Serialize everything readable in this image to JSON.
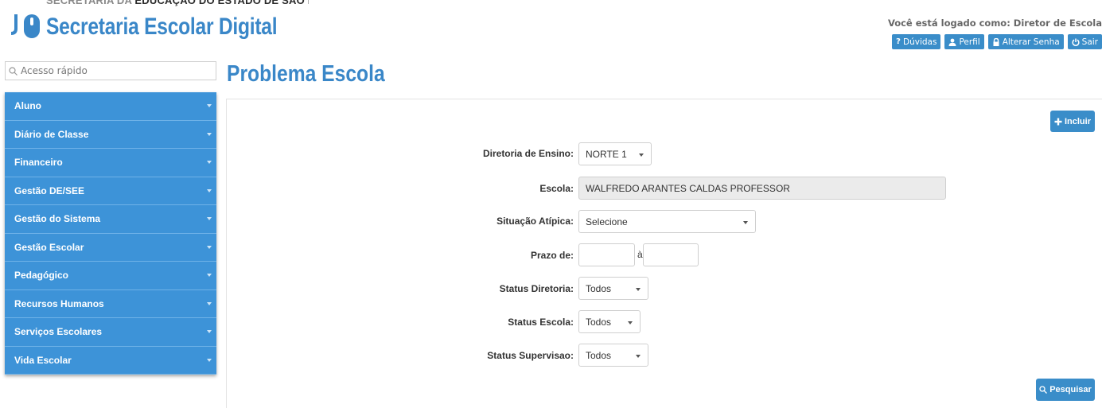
{
  "header": {
    "supertitle_dim": "SECRETARIA DA",
    "supertitle": "EDUCAÇÃO DO ESTADO DE SÃO PAULO",
    "app_title": "Secretaria Escolar Digital",
    "logged_as": "Você está logado como: Diretor de Escola",
    "buttons": [
      {
        "label": "Dúvidas",
        "icon": "question-icon"
      },
      {
        "label": "Perfil",
        "icon": "user-icon"
      },
      {
        "label": "Alterar Senha",
        "icon": "lock-icon"
      },
      {
        "label": "Sair",
        "icon": "power-icon"
      }
    ]
  },
  "quick_search": {
    "placeholder": "Acesso rápido",
    "icon": "search-icon"
  },
  "sidebar": {
    "items": [
      {
        "label": "Aluno"
      },
      {
        "label": "Diário de Classe"
      },
      {
        "label": "Financeiro"
      },
      {
        "label": "Gestão DE/SEE"
      },
      {
        "label": "Gestão do Sistema"
      },
      {
        "label": "Gestão Escolar"
      },
      {
        "label": "Pedagógico"
      },
      {
        "label": "Recursos Humanos"
      },
      {
        "label": "Serviços Escolares"
      },
      {
        "label": "Vida Escolar"
      }
    ]
  },
  "page": {
    "title": "Problema Escola",
    "include_label": "Incluir",
    "search_label": "Pesquisar"
  },
  "form": {
    "diretoria": {
      "label": "Diretoria de Ensino:",
      "value": "NORTE 1"
    },
    "escola": {
      "label": "Escola:",
      "value": "WALFREDO ARANTES CALDAS PROFESSOR"
    },
    "situacao": {
      "label": "Situação Atípica:",
      "value": "Selecione"
    },
    "prazo": {
      "label": "Prazo de:",
      "separator": "à",
      "from": "",
      "to": ""
    },
    "status_diretoria": {
      "label": "Status Diretoria:",
      "value": "Todos"
    },
    "status_escola": {
      "label": "Status Escola:",
      "value": "Todos"
    },
    "status_supervisao": {
      "label": "Status Supervisao:",
      "value": "Todos"
    }
  },
  "colors": {
    "accent": "#3a8dc9",
    "sidebar": "#3d93d8",
    "title": "#3a87c8"
  }
}
